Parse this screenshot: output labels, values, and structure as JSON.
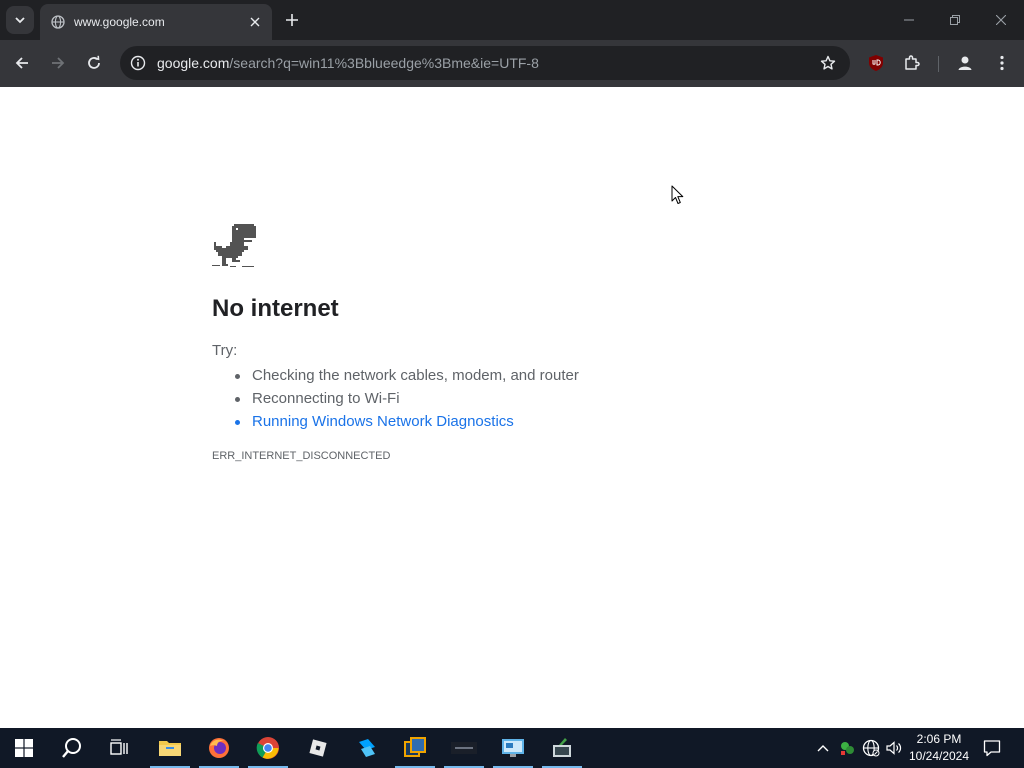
{
  "browser": {
    "tab": {
      "title": "www.google.com"
    },
    "address_bar": {
      "host": "google.com",
      "path": "/search?q=win11%3Bblueedge%3Bme&ie=UTF-8"
    },
    "icons": [
      "tab-search-icon",
      "globe-icon",
      "close-icon",
      "plus-icon",
      "minimize-icon",
      "restore-icon",
      "back-icon",
      "forward-icon",
      "reload-icon",
      "site-info-icon",
      "star-icon",
      "ublock-icon",
      "extensions-icon",
      "profile-icon",
      "menu-icon"
    ]
  },
  "error_page": {
    "title": "No internet",
    "try_label": "Try:",
    "suggestions": [
      "Checking the network cables, modem, and router",
      "Reconnecting to Wi-Fi",
      "Running Windows Network Diagnostics"
    ],
    "error_code": "ERR_INTERNET_DISCONNECTED"
  },
  "taskbar": {
    "apps": [
      "start",
      "search",
      "task-view",
      "file-explorer",
      "firefox",
      "chrome",
      "roblox",
      "roblox-studio",
      "virtualbox",
      "app-dark",
      "remote-desktop",
      "terminal-app"
    ],
    "clock": {
      "time": "2:06 PM",
      "date": "10/24/2024"
    }
  },
  "colors": {
    "tabstrip": "#202124",
    "toolbar": "#35363a",
    "link": "#1a73e8",
    "taskbar": "#101826"
  }
}
